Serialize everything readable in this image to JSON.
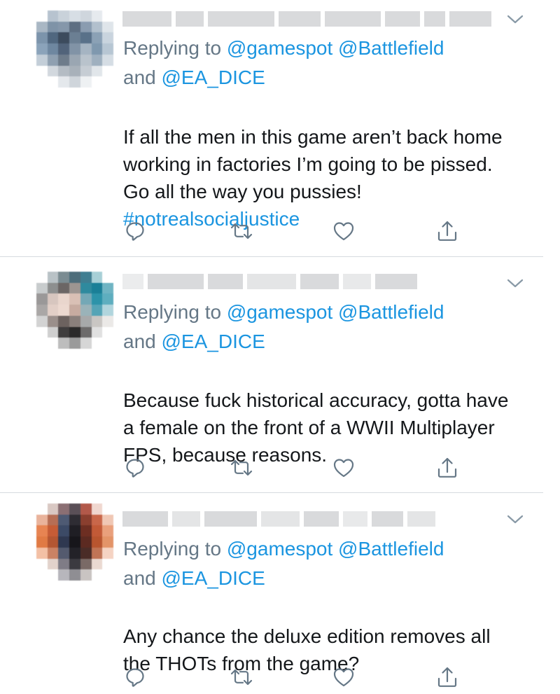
{
  "icons": {
    "reply": "reply-icon",
    "retweet": "retweet-icon",
    "like": "heart-icon",
    "share": "share-icon",
    "menu": "chevron-down-icon"
  },
  "colors": {
    "link": "#1b95e0",
    "muted": "#657786",
    "text": "#14171a",
    "divider": "#d6dbdf"
  },
  "tweets": [
    {
      "reply_prefix": "Replying to",
      "mention_1": "@gamespot",
      "mention_2": "@Battlefield",
      "conjunction": "and",
      "mention_3": "@EA_DICE",
      "text": "If all the men in this game aren’t back home working in factories I’m going to be pissed. Go all the way you pussies!",
      "hashtag": "#notrealsocialjustice"
    },
    {
      "reply_prefix": "Replying to",
      "mention_1": "@gamespot",
      "mention_2": "@Battlefield",
      "conjunction": "and",
      "mention_3": "@EA_DICE",
      "text": "Because fuck historical accuracy, gotta have a female on the front of a WWII Multiplayer FPS, because reasons."
    },
    {
      "reply_prefix": "Replying to",
      "mention_1": "@gamespot",
      "mention_2": "@Battlefield",
      "conjunction": "and",
      "mention_3": "@EA_DICE",
      "text": "Any chance the deluxe edition removes all the THOTs from the game?"
    }
  ]
}
